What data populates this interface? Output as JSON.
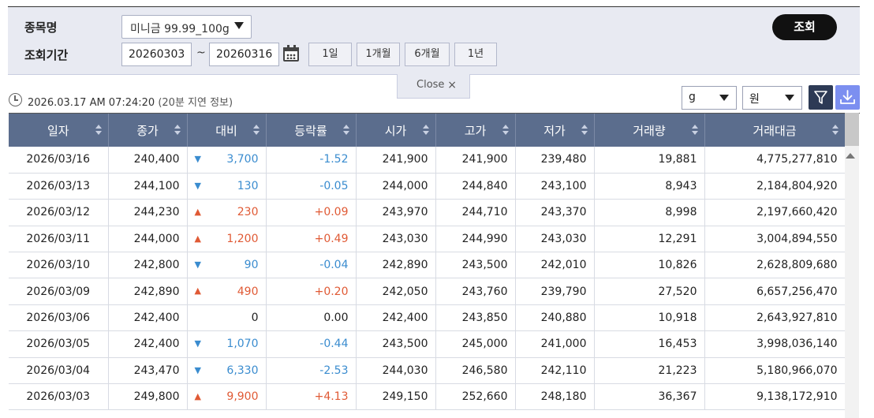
{
  "search": {
    "item_label": "종목명",
    "period_label": "조회기간",
    "item_value": "미니금 99.99_100g",
    "date_from": "20260303",
    "date_separator": "~",
    "date_to": "20260316",
    "period_buttons": [
      "1일",
      "1개월",
      "6개월",
      "1년"
    ],
    "query_button": "조회",
    "close_tab": "Close"
  },
  "info": {
    "timestamp": "2026.03.17 AM 07:24:20",
    "delay_note": "(20분 지연 정보)",
    "unit_weight": "g",
    "unit_currency": "원"
  },
  "table": {
    "headers": [
      "일자",
      "종가",
      "대비",
      "등락률",
      "시가",
      "고가",
      "저가",
      "거래량",
      "거래대금"
    ],
    "rows": [
      {
        "date": "2026/03/16",
        "close": "240,400",
        "dir": "down",
        "change": "3,700",
        "rate": "-1.52",
        "open": "241,900",
        "high": "241,900",
        "low": "239,480",
        "volume": "19,881",
        "amount": "4,775,277,810"
      },
      {
        "date": "2026/03/13",
        "close": "244,100",
        "dir": "down",
        "change": "130",
        "rate": "-0.05",
        "open": "244,000",
        "high": "244,840",
        "low": "243,100",
        "volume": "8,943",
        "amount": "2,184,804,920"
      },
      {
        "date": "2026/03/12",
        "close": "244,230",
        "dir": "up",
        "change": "230",
        "rate": "+0.09",
        "open": "243,970",
        "high": "244,710",
        "low": "243,370",
        "volume": "8,998",
        "amount": "2,197,660,420"
      },
      {
        "date": "2026/03/11",
        "close": "244,000",
        "dir": "up",
        "change": "1,200",
        "rate": "+0.49",
        "open": "243,030",
        "high": "244,990",
        "low": "243,030",
        "volume": "12,291",
        "amount": "3,004,894,550"
      },
      {
        "date": "2026/03/10",
        "close": "242,800",
        "dir": "down",
        "change": "90",
        "rate": "-0.04",
        "open": "242,890",
        "high": "243,500",
        "low": "242,010",
        "volume": "10,826",
        "amount": "2,628,809,680"
      },
      {
        "date": "2026/03/09",
        "close": "242,890",
        "dir": "up",
        "change": "490",
        "rate": "+0.20",
        "open": "242,050",
        "high": "243,760",
        "low": "239,790",
        "volume": "27,520",
        "amount": "6,657,256,470"
      },
      {
        "date": "2026/03/06",
        "close": "242,400",
        "dir": "none",
        "change": "0",
        "rate": "0.00",
        "open": "242,400",
        "high": "243,850",
        "low": "240,880",
        "volume": "10,918",
        "amount": "2,643,927,810"
      },
      {
        "date": "2026/03/05",
        "close": "242,400",
        "dir": "down",
        "change": "1,070",
        "rate": "-0.44",
        "open": "243,500",
        "high": "245,000",
        "low": "241,000",
        "volume": "16,453",
        "amount": "3,998,036,140"
      },
      {
        "date": "2026/03/04",
        "close": "243,470",
        "dir": "down",
        "change": "6,330",
        "rate": "-2.53",
        "open": "244,030",
        "high": "246,580",
        "low": "242,110",
        "volume": "21,223",
        "amount": "5,180,966,070"
      },
      {
        "date": "2026/03/03",
        "close": "249,800",
        "dir": "up",
        "change": "9,900",
        "rate": "+4.13",
        "open": "249,150",
        "high": "252,660",
        "low": "248,180",
        "volume": "36,367",
        "amount": "9,138,172,910"
      }
    ]
  },
  "colors": {
    "down": "#3a8ccf",
    "up": "#e05a35",
    "header_bg": "#5b6d8d"
  },
  "icons": {
    "calendar": "calendar-icon",
    "filter": "filter-icon",
    "download": "download-icon",
    "clock": "clock-icon"
  }
}
